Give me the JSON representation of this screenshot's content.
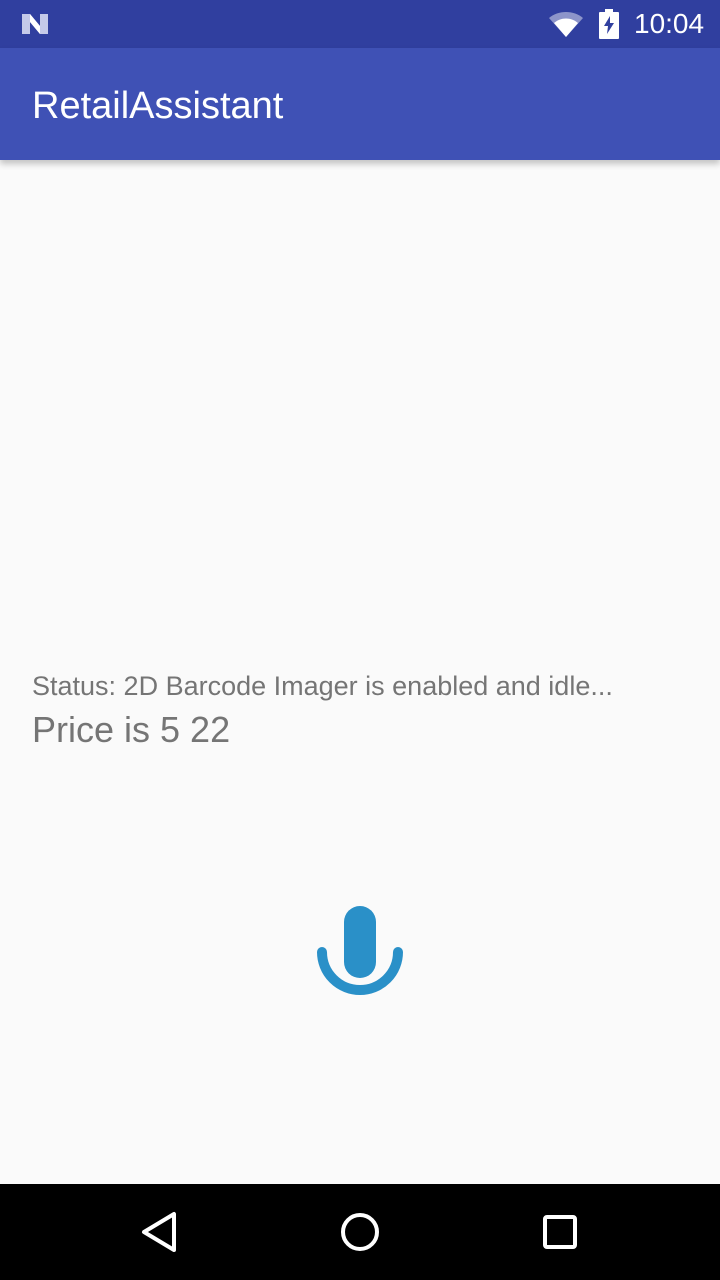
{
  "status_bar": {
    "time": "10:04",
    "icons": [
      "n-logo-icon",
      "wifi-icon",
      "battery-charging-icon"
    ]
  },
  "app_bar": {
    "title": "RetailAssistant",
    "color": "#3f51b5",
    "status_bar_color": "#303f9f"
  },
  "main": {
    "status": "Status: 2D Barcode Imager is enabled and idle...",
    "price": "Price is 5 22",
    "mic_icon": "microphone-icon",
    "mic_color": "#2a90c8"
  },
  "nav_bar": {
    "icons": [
      "back-icon",
      "home-icon",
      "recent-apps-icon"
    ]
  }
}
